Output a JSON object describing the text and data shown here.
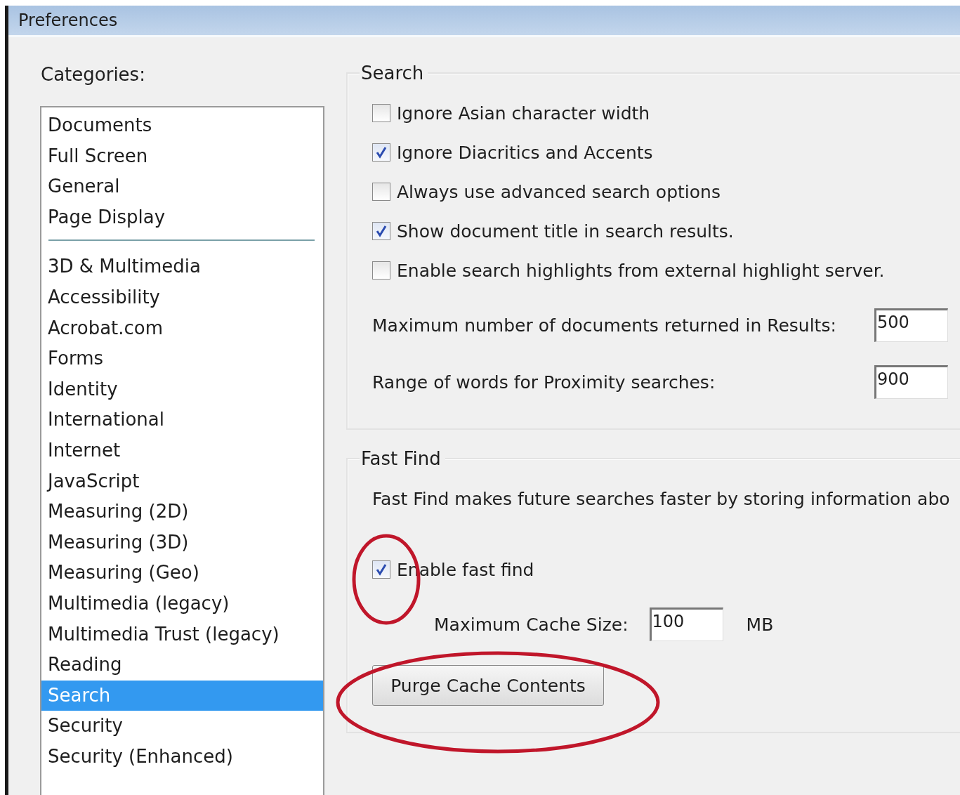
{
  "window": {
    "title": "Preferences"
  },
  "categories": {
    "label": "Categories:",
    "groups": [
      [
        {
          "label": "Documents",
          "selected": false
        },
        {
          "label": "Full Screen",
          "selected": false
        },
        {
          "label": "General",
          "selected": false
        },
        {
          "label": "Page Display",
          "selected": false
        }
      ],
      [
        {
          "label": "3D & Multimedia",
          "selected": false
        },
        {
          "label": "Accessibility",
          "selected": false
        },
        {
          "label": "Acrobat.com",
          "selected": false
        },
        {
          "label": "Forms",
          "selected": false
        },
        {
          "label": "Identity",
          "selected": false
        },
        {
          "label": "International",
          "selected": false
        },
        {
          "label": "Internet",
          "selected": false
        },
        {
          "label": "JavaScript",
          "selected": false
        },
        {
          "label": "Measuring (2D)",
          "selected": false
        },
        {
          "label": "Measuring (3D)",
          "selected": false
        },
        {
          "label": "Measuring (Geo)",
          "selected": false
        },
        {
          "label": "Multimedia (legacy)",
          "selected": false
        },
        {
          "label": "Multimedia Trust (legacy)",
          "selected": false
        },
        {
          "label": "Reading",
          "selected": false
        },
        {
          "label": "Search",
          "selected": true
        },
        {
          "label": "Security",
          "selected": false
        },
        {
          "label": "Security (Enhanced)",
          "selected": false
        }
      ]
    ]
  },
  "search": {
    "title": "Search",
    "checkboxes": [
      {
        "label": "Ignore Asian character width",
        "checked": false
      },
      {
        "label": "Ignore Diacritics and Accents",
        "checked": true
      },
      {
        "label": "Always use advanced search options",
        "checked": false
      },
      {
        "label": "Show document title in search results.",
        "checked": true
      },
      {
        "label": "Enable search highlights from external highlight server.",
        "checked": false
      }
    ],
    "fields": [
      {
        "label": "Maximum number of documents returned in Results:",
        "value": "500"
      },
      {
        "label": "Range of words for Proximity searches:",
        "value": "900"
      }
    ]
  },
  "fast_find": {
    "title": "Fast Find",
    "description": "Fast Find makes future searches faster by storing information abo",
    "checkbox": {
      "label": "Enable fast find",
      "checked": true
    },
    "cache": {
      "label": "Maximum Cache Size:",
      "value": "100",
      "unit": "MB"
    },
    "button": "Purge Cache Contents"
  },
  "annotations": [
    {
      "kind": "ellipse"
    },
    {
      "kind": "ellipse"
    }
  ]
}
